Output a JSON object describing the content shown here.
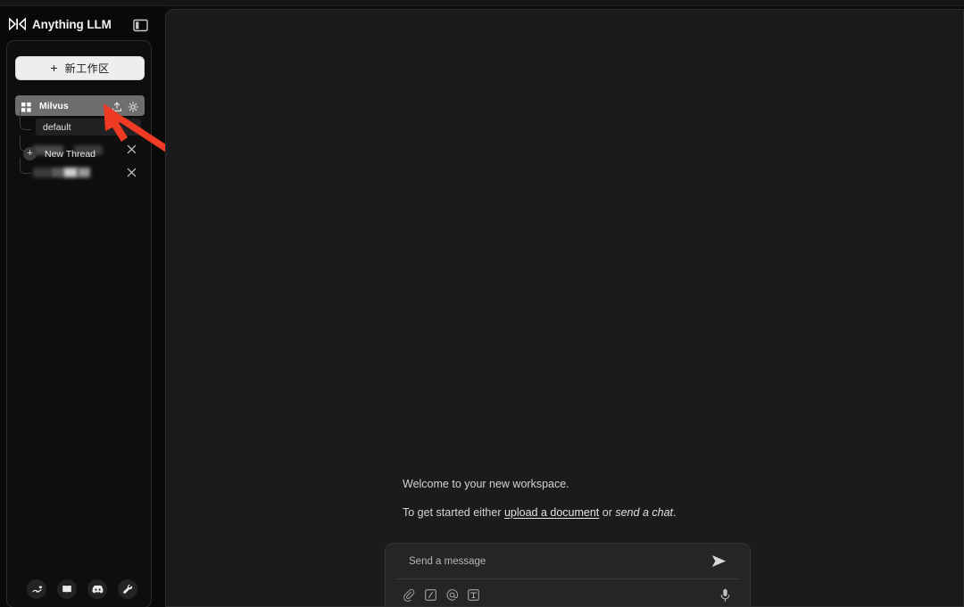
{
  "app": {
    "brand_name": "Anything LLM",
    "logo_icon": "anythingllm-logo-icon",
    "panel_toggle_icon": "sidebar-toggle-icon"
  },
  "sidebar": {
    "new_workspace": {
      "label": "新工作区",
      "plus": "+",
      "icon": "plus-icon"
    },
    "workspace": {
      "name": "Milvus",
      "grid_icon": "grid-squares-icon",
      "upload_icon": "upload-icon",
      "settings_icon": "gear-icon"
    },
    "threads": [
      {
        "label": "default",
        "redacted": false,
        "close_icon": "close-icon",
        "has_close": false
      },
      {
        "label": "",
        "redacted": true,
        "close_icon": "close-icon",
        "has_close": true
      },
      {
        "label": "",
        "redacted": true,
        "close_icon": "close-icon",
        "has_close": true
      }
    ],
    "new_thread": {
      "label": "New Thread",
      "plus": "+",
      "icon": "plus-circle-icon"
    },
    "footer_buttons": [
      {
        "name": "donate-icon",
        "title": "Support"
      },
      {
        "name": "book-icon",
        "title": "Docs"
      },
      {
        "name": "discord-icon",
        "title": "Discord"
      },
      {
        "name": "wrench-icon",
        "title": "Settings"
      }
    ]
  },
  "main": {
    "welcome_title": "Welcome to your new workspace.",
    "getstarted_prefix": "To get started either ",
    "getstarted_link": "upload a document",
    "getstarted_mid": " or ",
    "getstarted_italic": "send a chat",
    "getstarted_suffix": "."
  },
  "composer": {
    "placeholder": "Send a message",
    "value": "",
    "send_icon": "send-arrow-icon",
    "mic_icon": "microphone-icon",
    "tools": [
      {
        "name": "attachment-icon"
      },
      {
        "name": "slash-command-icon"
      },
      {
        "name": "at-mention-icon"
      },
      {
        "name": "text-prompt-icon"
      }
    ]
  },
  "annotation": {
    "arrow_color": "#ef3b24",
    "arrow_icon": "red-pointer-arrow-icon"
  },
  "colors": {
    "page_bg": "#0b0b0c",
    "rail_bg": "#090909",
    "sidebar_bg": "#0e0e0f",
    "main_bg": "#1b1b1d",
    "accent_button": "#eeeeee",
    "workspace_selected": "#6e6e6e"
  }
}
